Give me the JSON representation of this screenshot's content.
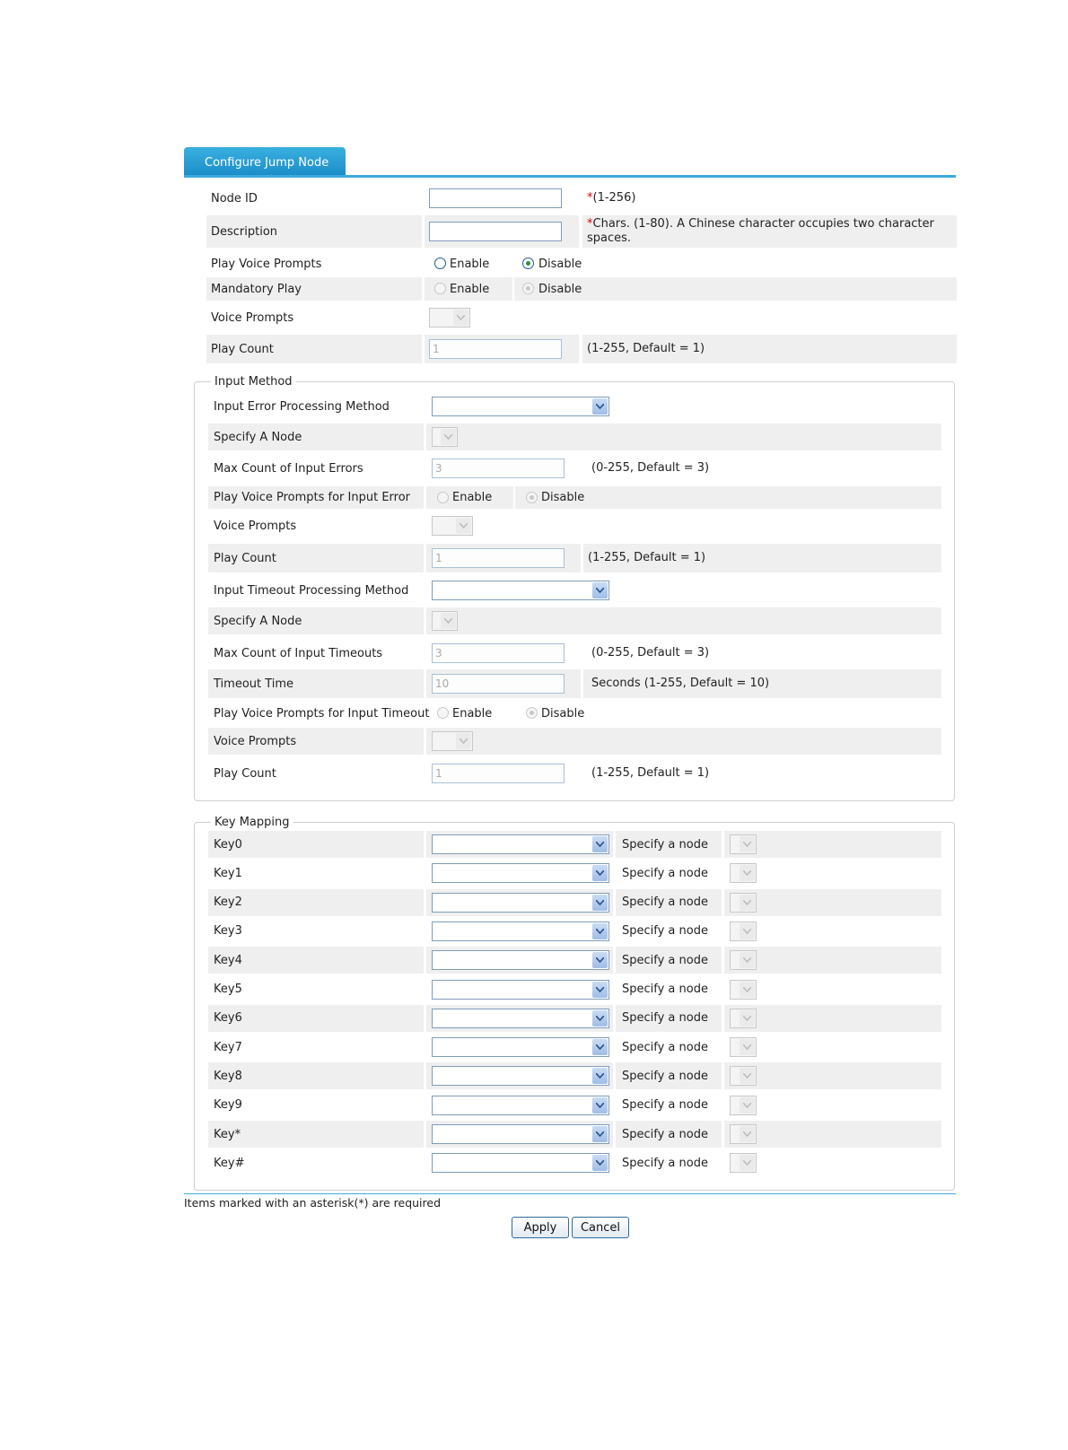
{
  "tab": {
    "title": "Configure Jump Node"
  },
  "fields": {
    "node_id": {
      "label": "Node ID",
      "value": "",
      "hint_req": "*",
      "hint": "(1-256)"
    },
    "description": {
      "label": "Description",
      "value": "",
      "hint_req": "*",
      "hint_line1": "Chars. (1-80). A Chinese character occupies two character",
      "hint_line2": "spaces."
    },
    "play_voice_prompts": {
      "label": "Play Voice Prompts",
      "enable": "Enable",
      "disable": "Disable",
      "selected": "Disable"
    },
    "mandatory_play": {
      "label": "Mandatory Play",
      "enable": "Enable",
      "disable": "Disable",
      "selected": "Disable"
    },
    "voice_prompts": {
      "label": "Voice Prompts"
    },
    "play_count": {
      "label": "Play Count",
      "value": "1",
      "hint": "(1-255, Default = 1)"
    }
  },
  "input_method": {
    "legend": "Input Method",
    "error_method_label": "Input Error Processing Method",
    "specify_node_label": "Specify A Node",
    "max_errors_label": "Max Count of Input Errors",
    "max_errors_value": "3",
    "max_errors_hint": "(0-255, Default = 3)",
    "play_error_label": "Play Voice Prompts for Input Error",
    "enable": "Enable",
    "disable": "Disable",
    "voice_prompts_label": "Voice Prompts",
    "play_count_label": "Play Count",
    "play_count_value": "1",
    "play_count_hint": "(1-255, Default = 1)",
    "timeout_method_label": "Input Timeout Processing Method",
    "specify_node2_label": "Specify A Node",
    "max_timeouts_label": "Max Count of Input Timeouts",
    "max_timeouts_value": "3",
    "max_timeouts_hint": "(0-255, Default = 3)",
    "timeout_time_label": "Timeout Time",
    "timeout_time_value": "10",
    "timeout_time_hint": "Seconds (1-255, Default = 10)",
    "play_timeout_label": "Play Voice Prompts for Input Timeout",
    "voice_prompts2_label": "Voice Prompts",
    "play_count2_label": "Play Count",
    "play_count2_value": "1",
    "play_count2_hint": "(1-255, Default = 1)"
  },
  "key_mapping": {
    "legend": "Key Mapping",
    "specify_label": "Specify a node",
    "keys": [
      "Key0",
      "Key1",
      "Key2",
      "Key3",
      "Key4",
      "Key5",
      "Key6",
      "Key7",
      "Key8",
      "Key9",
      "Key*",
      "Key#"
    ]
  },
  "footer": {
    "note": "Items marked with an asterisk(*) are required",
    "apply": "Apply",
    "cancel": "Cancel"
  }
}
